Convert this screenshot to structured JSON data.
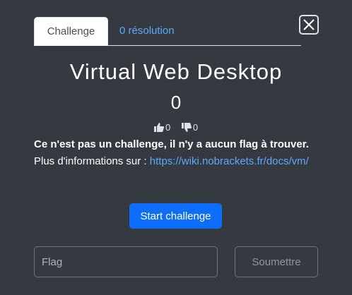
{
  "tabs": [
    {
      "label": "Challenge",
      "active": true
    },
    {
      "label": "0 résolution",
      "active": false
    }
  ],
  "challenge": {
    "title": "Virtual Web Desktop",
    "points": "0",
    "likes": "0",
    "dislikes": "0",
    "notice": "Ce n'est pas un challenge, il n'y a aucun flag à trouver.",
    "info_prefix": "Plus d'informations sur : ",
    "info_link": "https://wiki.nobrackets.fr/docs/vm/"
  },
  "actions": {
    "start_label": "Start challenge",
    "flag_placeholder": "Flag",
    "submit_label": "Soumettre"
  },
  "icons": {
    "close": "close-icon",
    "like": "thumbs-up-icon",
    "dislike": "thumbs-down-icon"
  },
  "colors": {
    "background": "#343a40",
    "accent": "#0d6efd",
    "link": "#5ea8ff"
  }
}
